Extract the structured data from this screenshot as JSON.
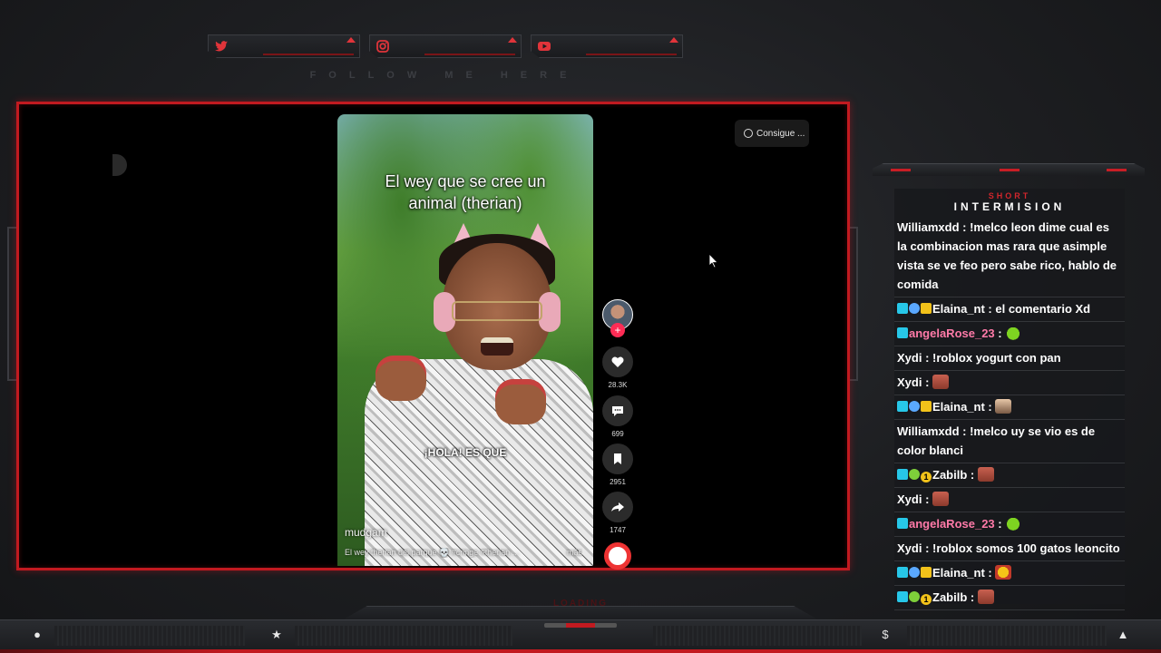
{
  "social": {
    "items": [
      {
        "icon": "twitter-icon",
        "color": "#e0343a"
      },
      {
        "icon": "instagram-icon",
        "color": "#e0343a"
      },
      {
        "icon": "youtube-icon",
        "color": "#e0343a"
      }
    ],
    "follow_text": "FOLLOW ME HERE"
  },
  "player": {
    "promo_button": "Consigue ...",
    "caption_top": "El wey que se cree un animal (therian)",
    "caption_mid": "¡HOLA! ES QUE",
    "username": "mudgam",
    "description": "El wey therian del parque 💀 #cringe #therian ...",
    "more_label": "más",
    "likes": "28.3K",
    "comments": "699",
    "bookmarks": "2951",
    "shares": "1747"
  },
  "chat": {
    "header_small": "SHORT",
    "header_big": "INTERMISION",
    "messages": [
      {
        "user": "Williamxdd",
        "badges": [],
        "text": "!melco leon dime cual es la combinacion mas rara que asimple vista se ve feo pero sabe rico, hablo de comida",
        "pink": false
      },
      {
        "user": "Elaina_nt",
        "badges": [
          "cyan",
          "blue",
          "crown"
        ],
        "text": "el comentario Xd",
        "pink": false
      },
      {
        "user": "angelaRose_23",
        "badges": [
          "cyan"
        ],
        "text": "",
        "emote": "frog",
        "pink": true
      },
      {
        "user": "Xydi",
        "badges": [],
        "text": "!roblox yogurt con pan",
        "pink": false
      },
      {
        "user": "Xydi",
        "badges": [],
        "text": "",
        "emote": "face",
        "pink": false
      },
      {
        "user": "Elaina_nt",
        "badges": [
          "cyan",
          "blue",
          "crown"
        ],
        "text": "",
        "emote": "cat",
        "pink": false
      },
      {
        "user": "Williamxdd",
        "badges": [],
        "text": "!melco uy se vio es de color blanci",
        "pink": false
      },
      {
        "user": "Zabilb",
        "badges": [
          "cyan",
          "green",
          "gold"
        ],
        "text": "",
        "emote": "face",
        "pink": false
      },
      {
        "user": "Xydi",
        "badges": [],
        "text": "",
        "emote": "face",
        "pink": false
      },
      {
        "user": "angelaRose_23",
        "badges": [
          "cyan"
        ],
        "text": "",
        "emote": "frog",
        "pink": true
      },
      {
        "user": "Xydi",
        "badges": [],
        "text": "!roblox somos 100 gatos leoncito",
        "pink": false
      },
      {
        "user": "Elaina_nt",
        "badges": [
          "cyan",
          "blue",
          "crown"
        ],
        "text": "",
        "emote": "star",
        "pink": false
      },
      {
        "user": "Zabilb",
        "badges": [
          "cyan",
          "green",
          "gold"
        ],
        "text": "",
        "emote": "face",
        "pink": false
      }
    ]
  },
  "bottom_bar": {
    "loading_text": "LOADING",
    "icons": [
      "user-icon",
      "star-icon",
      "dollar-icon",
      "drop-icon"
    ],
    "icon_glyphs": [
      "●",
      "★",
      "$",
      "▲"
    ]
  },
  "colors": {
    "accent_red": "#c21a20",
    "chat_pink": "#ff7aa8",
    "background": "#1d1e21"
  }
}
